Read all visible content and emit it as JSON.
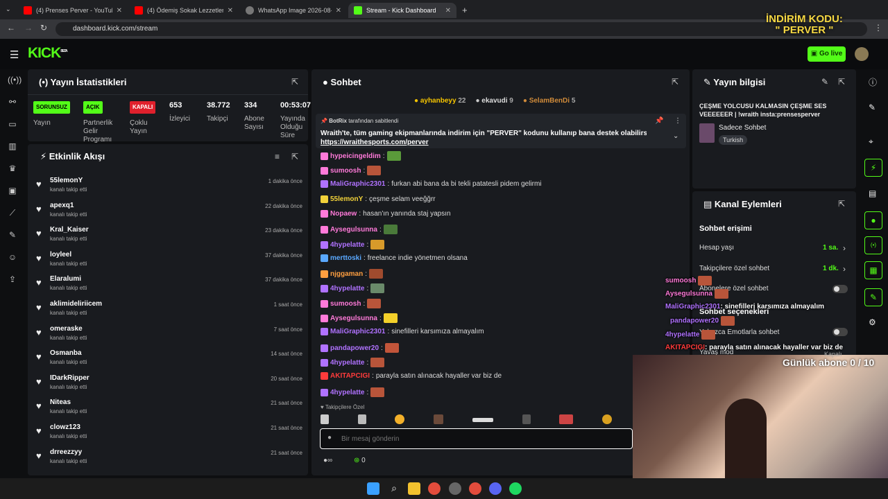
{
  "browser": {
    "tabs": [
      {
        "label": "(4) Prenses Perver - YouTube",
        "color": "#ff0000"
      },
      {
        "label": "(4) Ödemiş Sokak Lezzetleri | -",
        "color": "#ff0000"
      },
      {
        "label": "WhatsApp Image 2026-08-08 a",
        "color": "#666"
      },
      {
        "label": "Stream - Kick Dashboard",
        "color": "#53fc18"
      }
    ],
    "url": "dashboard.kick.com/stream",
    "new_tab": "+"
  },
  "header": {
    "logo": "KICK",
    "beta": "BETA",
    "go_live": "Go live"
  },
  "promo": {
    "line1": "İNDİRİM KODU:",
    "line2": "\" PERVER \""
  },
  "stats": {
    "title": "Yayın İstatistikleri",
    "cols": [
      {
        "badge": "SORUNSUZ",
        "badge_color": "#53fc18",
        "label": "Yayın"
      },
      {
        "badge": "AÇIK",
        "badge_color": "#53fc18",
        "label": "Partnerlik Gelir Programı"
      },
      {
        "badge": "KAPALI",
        "badge_color": "#e0202c",
        "label": "Çoklu Yayın"
      },
      {
        "value": "653",
        "label": "İzleyici"
      },
      {
        "value": "38.772",
        "label": "Takipçi"
      },
      {
        "value": "334",
        "label": "Abone Sayısı"
      },
      {
        "value": "00:53:07",
        "label": "Yayında Olduğu Süre"
      }
    ]
  },
  "activity": {
    "title": "Etkinlik Akışı",
    "items": [
      {
        "name": "55lemonY",
        "sub": "kanalı takip etti",
        "time": "1 dakika önce"
      },
      {
        "name": "apexq1",
        "sub": "kanalı takip etti",
        "time": "22 dakika önce"
      },
      {
        "name": "Kral_Kaiser",
        "sub": "kanalı takip etti",
        "time": "23 dakika önce"
      },
      {
        "name": "loyleel",
        "sub": "kanalı takip etti",
        "time": "37 dakika önce"
      },
      {
        "name": "Elaralumi",
        "sub": "kanalı takip etti",
        "time": "37 dakika önce"
      },
      {
        "name": "aklimideliriicem",
        "sub": "kanalı takip etti",
        "time": "1 saat önce"
      },
      {
        "name": "omeraske",
        "sub": "kanalı takip etti",
        "time": "7 saat önce"
      },
      {
        "name": "Osmanba",
        "sub": "kanalı takip etti",
        "time": "14 saat önce"
      },
      {
        "name": "IDarkRipper",
        "sub": "kanalı takip etti",
        "time": "20 saat önce"
      },
      {
        "name": "Niteas",
        "sub": "kanalı takip etti",
        "time": "21 saat önce"
      },
      {
        "name": "clowz123",
        "sub": "kanalı takip etti",
        "time": "21 saat önce"
      },
      {
        "name": "drreezzyy",
        "sub": "kanalı takip etti",
        "time": "21 saat önce"
      }
    ]
  },
  "chat": {
    "title": "Sohbet",
    "top": [
      {
        "name": "ayhanbeyy",
        "count": "22"
      },
      {
        "name": "ekavudi",
        "count": "9"
      },
      {
        "name": "SelamBenDi",
        "count": "5"
      }
    ],
    "pinned": {
      "by": "BotRix",
      "by_suffix": "tarafından sabitlendi",
      "text": "Wraith'te, tüm gaming ekipmanlarında indirim için \"PERVER\" kodunu kullanıp bana destek olabilirsiniz!",
      "link": "https://wraithesports.com/perver"
    },
    "messages": [
      {
        "user": "hypeicingeldim",
        "color": "#ff7ad9",
        "text": ""
      },
      {
        "user": "sumoosh",
        "color": "#ff7ad9",
        "text": ""
      },
      {
        "user": "MaliGraphic2301",
        "color": "#b072ff",
        "text": "furkan abi bana da bi tekli patatesli pidem gelirmi"
      },
      {
        "user": "55lemonY",
        "color": "#f2d23a",
        "text": "çeşme selam veeğğrr"
      },
      {
        "user": "Nopaew",
        "color": "#ff7ad9",
        "text": "hasan'ın yanında staj yapsın"
      },
      {
        "user": "Aysegulsunna",
        "color": "#ff7ad9",
        "text": ""
      },
      {
        "user": "4hypelatte",
        "color": "#b072ff",
        "text": ""
      },
      {
        "user": "merttoski",
        "color": "#5aa8ff",
        "text": "freelance indie yönetmen olsana"
      },
      {
        "user": "njggaman",
        "color": "#ff9f40",
        "text": ""
      },
      {
        "user": "4hypelatte",
        "color": "#b072ff",
        "text": ""
      },
      {
        "user": "sumoosh",
        "color": "#ff7ad9",
        "text": ""
      },
      {
        "user": "Aysegulsunna",
        "color": "#ff7ad9",
        "text": ""
      },
      {
        "user": "MaliGraphic2301",
        "color": "#b072ff",
        "text": "sinefilleri karsımıza almayalım"
      },
      {
        "user": "pandapower20",
        "color": "#b072ff",
        "text": ""
      },
      {
        "user": "4hypelatte",
        "color": "#b072ff",
        "text": ""
      },
      {
        "user": "AKITAPCIGI",
        "color": "#ff3b3b",
        "text": "parayla satın alınacak hayaller var biz de"
      },
      {
        "user": "4hypelatte",
        "color": "#b072ff",
        "text": ""
      }
    ],
    "followers_only": "Takipçilere Özel",
    "placeholder": "Bir mesaj gönderin",
    "count": "0"
  },
  "info": {
    "title": "Yayın bilgisi",
    "stream_title": "ÇEŞME YOLCUSU KALMASIN ÇEŞME SES VEEEEEER | !wraith insta:prensesperver",
    "category": "Sadece Sohbet",
    "tag": "Turkish"
  },
  "actions": {
    "title": "Kanal Eylemleri",
    "section1": "Sohbet erişimi",
    "rows": [
      {
        "label": "Hesap yaşı",
        "value": "1 sa."
      },
      {
        "label": "Takipçilere özel sohbet",
        "value": "1 dk."
      },
      {
        "label": "Abonelere özel sohbet",
        "value": ""
      }
    ],
    "section2": "Sohbet seçenekleri",
    "rows2": [
      {
        "label": "Yalnızca Emotlarla sohbet"
      },
      {
        "label": "Yavaş mod",
        "value": "Kapalı"
      }
    ]
  },
  "overlay": {
    "chat": [
      {
        "user": "sumoosh",
        "color": "#ff7ad9",
        "text": ""
      },
      {
        "user": "Aysegulsunna",
        "color": "#ff7ad9",
        "text": ""
      },
      {
        "user": "MaliGraphic2301",
        "color": "#b072ff",
        "text": ": sinefilleri karsımıza almayalım"
      },
      {
        "user": "pandapower20",
        "color": "#b072ff",
        "text": ""
      },
      {
        "user": "4hypelatte",
        "color": "#b072ff",
        "text": ""
      },
      {
        "user": "AKITAPCIGI",
        "color": "#ff3b3b",
        "text": ": parayla satın alınacak hayaller var biz de"
      }
    ],
    "sub_goal": "Günlük abone 0 / 10"
  }
}
